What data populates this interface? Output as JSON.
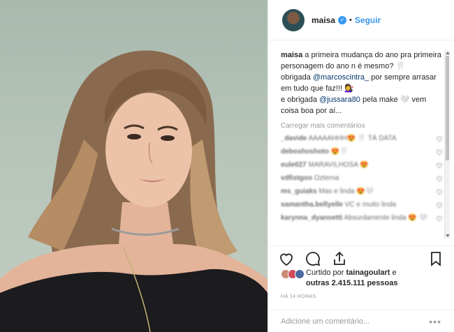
{
  "header": {
    "username": "maisa",
    "separator": "•",
    "follow_label": "Seguir"
  },
  "caption": {
    "username": "maisa",
    "line1": "a primeira mudança do ano pra primeira personagem do ano n é mesmo?",
    "emoji1": "🦷",
    "thanks1_prefix": "obrigada",
    "mention1": "@marcoscintra_",
    "thanks1_suffix": "por sempre arrasar em tudo que faz!!! 💇‍♀️",
    "thanks2_prefix": "e obrigada",
    "mention2": "@jussara80",
    "thanks2_suffix": "pela make 🤍 vem coisa boa por aí..."
  },
  "load_more": "Carregar mais comentários",
  "comments": [
    {
      "user": "_davide",
      "text": "AAAAAHHH😍 🦷 TÁ DATA"
    },
    {
      "user": "deboshoshoto",
      "text": "😍🦷"
    },
    {
      "user": "eule027",
      "text": "MARAVILHOSA 😍"
    },
    {
      "user": "vdfistgoo",
      "text": "Ozterna"
    },
    {
      "user": "ms_guiaks",
      "text": "Mas e linda 😍🤍"
    },
    {
      "user": "samantha.bellyelle",
      "text": "VC e muito linda"
    },
    {
      "user": "karynna_dyanoetti",
      "text": "Absurdamente linda 😍 🤍"
    }
  ],
  "likes": {
    "prefix": "Curtido por",
    "user": "tainagoulart",
    "middle": "e",
    "others": "outras 2.415.111 pessoas"
  },
  "timestamp": "HÁ 14 HORAS",
  "add_comment": {
    "placeholder": "Adicione um comentário...",
    "more": "•••"
  },
  "icons": {
    "verified": "verified-badge-icon",
    "like": "heart-icon",
    "comment": "comment-bubble-icon",
    "share": "share-icon",
    "save": "bookmark-icon"
  },
  "colors": {
    "link_blue": "#3897f0",
    "mention_blue": "#003569",
    "muted_gray": "#999999",
    "border": "#efefef"
  }
}
